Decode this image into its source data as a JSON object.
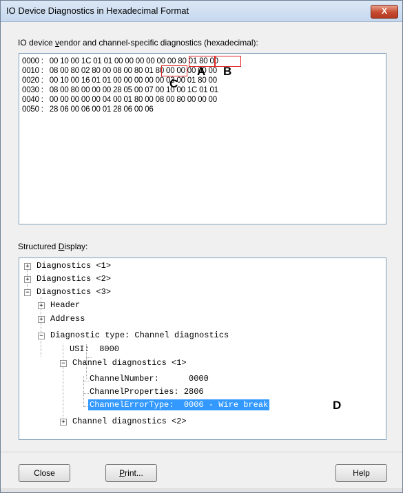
{
  "window": {
    "title": "IO Device Diagnostics in Hexadecimal Format",
    "close_glyph": "X"
  },
  "hex_section": {
    "label_pre": "IO device ",
    "label_ul": "v",
    "label_post": "endor and channel-specific diagnostics (hexadecimal):",
    "lines": [
      "0000 :   00 10 00 1C 01 01 00 00 00 00 00 00 80 01 80 00",
      "0010 :   08 00 80 02 80 00 08 00 80 01 80 00 00 00 00 00",
      "0020 :   00 10 00 16 01 01 00 00 00 00 00 03 00 01 80 00",
      "0030 :   08 00 80 00 00 00 28 05 00 07 00 10 00 1C 01 01",
      "0040 :   00 00 00 00 00 04 00 01 80 00 08 00 80 00 00 00",
      "0050 :   28 06 00 06 00 01 28 06 00 06"
    ],
    "markers": {
      "a": "A",
      "b": "B",
      "c": "C"
    }
  },
  "tree_section": {
    "label_pre": "Structured ",
    "label_ul": "D",
    "label_post": "isplay:",
    "nodes": [
      "Diagnostics <1>",
      "Diagnostics <2>",
      "Diagnostics <3>",
      "Header",
      "Address",
      "Diagnostic type: Channel diagnostics",
      "USI:  8000",
      "Channel diagnostics <1>",
      "ChannelNumber:      0000",
      "ChannelProperties: 2806",
      "ChannelErrorType:  0006 - Wire break",
      "Channel diagnostics <2>"
    ],
    "marker_d": "D",
    "expander_plus": "+",
    "expander_minus": "−"
  },
  "buttons": {
    "close": "Close",
    "print_ul": "P",
    "print_rest": "rint...",
    "help": "Help"
  },
  "colors": {
    "selection": "#3399ff",
    "highlight_box": "#e02020",
    "close_button": "#c64a2e"
  }
}
